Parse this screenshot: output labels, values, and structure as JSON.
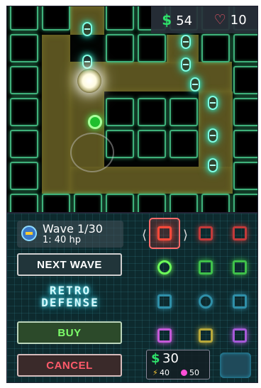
{
  "hud": {
    "money_symbol": "$",
    "money": "54",
    "lives_icon": "heart-icon",
    "lives": "10"
  },
  "map": {
    "creep_icon": "capsule-creep-icon"
  },
  "wave": {
    "title": "Wave 1/30",
    "subtitle": "1: 40 hp"
  },
  "buttons": {
    "next_wave": "NEXT WAVE",
    "buy": "BUY",
    "cancel": "CANCEL"
  },
  "logo": {
    "line1": "RETRO",
    "line2": "DEFENSE"
  },
  "shop": {
    "arrow_left": "⟨",
    "arrow_right": "⟩",
    "selected_tower": "red-cross-tower",
    "price_symbol": "$",
    "price": "30",
    "damage": "40",
    "range": "50"
  },
  "colors": {
    "grid_green": "#3fb07a",
    "path_olive": "#5a5320",
    "creep_cyan": "#7fffe6",
    "money_green": "#2ee06a",
    "cancel_red": "#ff5a6a",
    "buy_green": "#7dff6a"
  }
}
